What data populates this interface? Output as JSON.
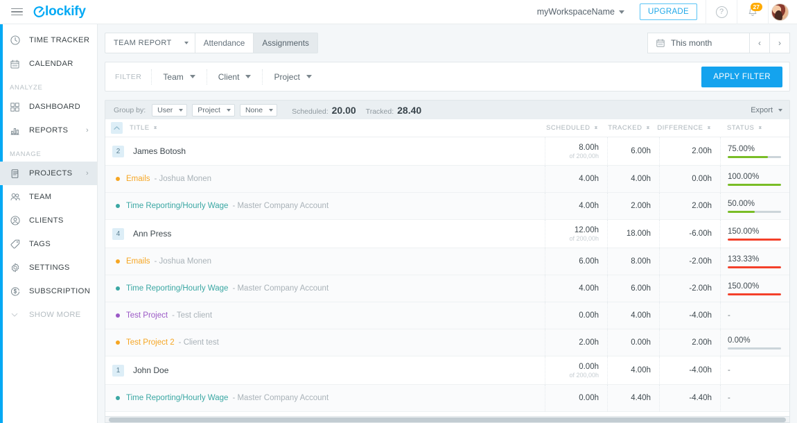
{
  "topbar": {
    "menu_icon": "hamburger-icon",
    "brand": "lockify",
    "brand_mark": "C",
    "workspace": "myWorkspaceName",
    "upgrade_label": "UPGRADE",
    "help_icon": "question-circle-icon",
    "bell_icon": "bell-icon",
    "notification_count": "27",
    "avatar_icon": "user-avatar"
  },
  "sidebar": {
    "items": [
      {
        "label": "TIME TRACKER",
        "icon": "clock-icon",
        "chevron": false,
        "active": false,
        "muted": false
      },
      {
        "label": "CALENDAR",
        "icon": "calendar-icon",
        "chevron": false,
        "active": false,
        "muted": false
      }
    ],
    "group_analyze": "ANALYZE",
    "analyze_items": [
      {
        "label": "DASHBOARD",
        "icon": "dashboard-grid-icon",
        "chevron": false,
        "active": false,
        "muted": false
      },
      {
        "label": "REPORTS",
        "icon": "bar-chart-icon",
        "chevron": true,
        "active": false,
        "muted": false
      }
    ],
    "group_manage": "MANAGE",
    "manage_items": [
      {
        "label": "PROJECTS",
        "icon": "document-icon",
        "chevron": true,
        "active": true,
        "muted": false
      },
      {
        "label": "TEAM",
        "icon": "team-icon",
        "chevron": false,
        "active": false,
        "muted": false
      },
      {
        "label": "CLIENTS",
        "icon": "client-person-icon",
        "chevron": false,
        "active": false,
        "muted": false
      },
      {
        "label": "TAGS",
        "icon": "tag-icon",
        "chevron": false,
        "active": false,
        "muted": false
      },
      {
        "label": "SETTINGS",
        "icon": "gear-icon",
        "chevron": false,
        "active": false,
        "muted": false
      },
      {
        "label": "SUBSCRIPTION",
        "icon": "dollar-refresh-icon",
        "chevron": false,
        "active": false,
        "muted": false
      }
    ],
    "show_more": {
      "label": "SHOW MORE",
      "icon": "chevron-down-icon"
    }
  },
  "tabs": [
    {
      "label": "TEAM REPORT",
      "has_caret": true,
      "active": false
    },
    {
      "label": "Attendance",
      "has_caret": false,
      "active": false
    },
    {
      "label": "Assignments",
      "has_caret": false,
      "active": true
    }
  ],
  "daterange": {
    "calendar_icon": "calendar-icon",
    "value": "This month",
    "prev": "‹",
    "next": "›"
  },
  "filterbar": {
    "label": "FILTER",
    "items": [
      "Team",
      "Client",
      "Project"
    ],
    "apply_label": "APPLY FILTER"
  },
  "groupbar": {
    "label": "Group by:",
    "selects": [
      "User",
      "Project",
      "None"
    ],
    "scheduled_label": "Scheduled:",
    "scheduled_value": "20.00",
    "tracked_label": "Tracked:",
    "tracked_value": "28.40",
    "export_label": "Export"
  },
  "table": {
    "collapse_icon": "chevron-up-icon",
    "columns": [
      {
        "label": "TITLE",
        "sortable": true
      },
      {
        "label": "SCHEDULED",
        "sortable": true
      },
      {
        "label": "TRACKED",
        "sortable": true
      },
      {
        "label": "DIFFERENCE",
        "sortable": true
      },
      {
        "label": "STATUS",
        "sortable": true
      }
    ],
    "rows": [
      {
        "type": "user",
        "badge": "2",
        "title": "James Botosh",
        "scheduled": "8.00h",
        "scheduled_sub": "of 200,00h",
        "tracked": "6.00h",
        "difference": "2.00h",
        "status": "75.00%",
        "status_pct": 75,
        "status_color": "#79bd26"
      },
      {
        "type": "project",
        "dot_color": "#f6a623",
        "name_color": "#f6a623",
        "title": "Emails",
        "client": "- Joshua Monen",
        "scheduled": "4.00h",
        "scheduled_sub": "",
        "tracked": "4.00h",
        "difference": "0.00h",
        "status": "100.00%",
        "status_pct": 100,
        "status_color": "#79bd26"
      },
      {
        "type": "project",
        "dot_color": "#3aa7a3",
        "name_color": "#3aa7a3",
        "title": "Time Reporting/Hourly Wage",
        "client": "- Master Company Account",
        "scheduled": "4.00h",
        "scheduled_sub": "",
        "tracked": "2.00h",
        "difference": "2.00h",
        "status": "50.00%",
        "status_pct": 50,
        "status_color": "#79bd26"
      },
      {
        "type": "user",
        "badge": "4",
        "title": "Ann Press",
        "scheduled": "12.00h",
        "scheduled_sub": "of 200,00h",
        "tracked": "18.00h",
        "difference": "-6.00h",
        "status": "150.00%",
        "status_pct": 100,
        "status_color": "#f4402a"
      },
      {
        "type": "project",
        "dot_color": "#f6a623",
        "name_color": "#f6a623",
        "title": "Emails",
        "client": "- Joshua Monen",
        "scheduled": "6.00h",
        "scheduled_sub": "",
        "tracked": "8.00h",
        "difference": "-2.00h",
        "status": "133.33%",
        "status_pct": 100,
        "status_color": "#f4402a"
      },
      {
        "type": "project",
        "dot_color": "#3aa7a3",
        "name_color": "#3aa7a3",
        "title": "Time Reporting/Hourly Wage",
        "client": "- Master Company Account",
        "scheduled": "4.00h",
        "scheduled_sub": "",
        "tracked": "6.00h",
        "difference": "-2.00h",
        "status": "150.00%",
        "status_pct": 100,
        "status_color": "#f4402a"
      },
      {
        "type": "project",
        "dot_color": "#9b59c6",
        "name_color": "#9b59c6",
        "title": "Test Project",
        "client": "- Test client",
        "scheduled": "0.00h",
        "scheduled_sub": "",
        "tracked": "4.00h",
        "difference": "-4.00h",
        "status": "-",
        "status_pct": null,
        "status_color": ""
      },
      {
        "type": "project",
        "dot_color": "#f6a623",
        "name_color": "#f6a623",
        "title": "Test Project 2",
        "client": "- Client test",
        "scheduled": "2.00h",
        "scheduled_sub": "",
        "tracked": "0.00h",
        "difference": "2.00h",
        "status": "0.00%",
        "status_pct": 0,
        "status_color": "#79bd26"
      },
      {
        "type": "user",
        "badge": "1",
        "title": "John Doe",
        "scheduled": "0.00h",
        "scheduled_sub": "of 200,00h",
        "tracked": "4.00h",
        "difference": "-4.00h",
        "status": "-",
        "status_pct": null,
        "status_color": ""
      },
      {
        "type": "project",
        "dot_color": "#3aa7a3",
        "name_color": "#3aa7a3",
        "title": "Time Reporting/Hourly Wage",
        "client": "- Master Company Account",
        "scheduled": "0.00h",
        "scheduled_sub": "",
        "tracked": "4.40h",
        "difference": "-4.40h",
        "status": "-",
        "status_pct": null,
        "status_color": ""
      }
    ]
  },
  "colors": {
    "accent": "#03a9f4",
    "apply_button": "#14a3ee",
    "progress_green": "#79bd26",
    "progress_red": "#f4402a",
    "badge_orange": "#ffab00"
  }
}
